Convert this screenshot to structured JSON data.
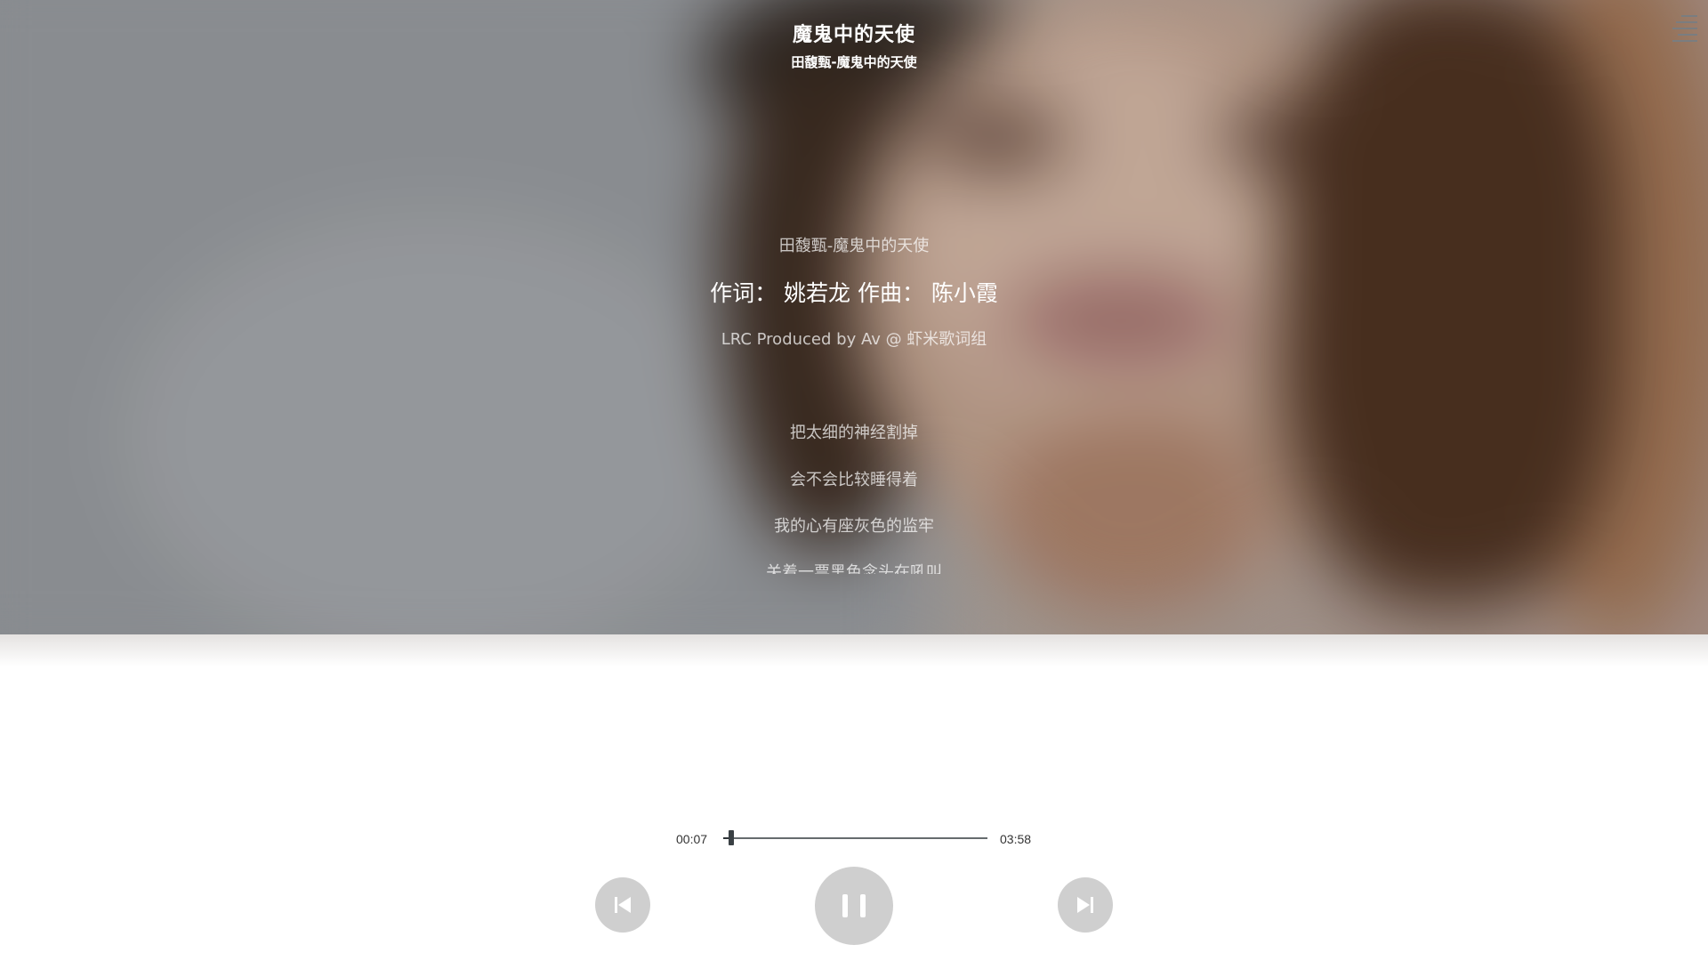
{
  "header": {
    "title": "魔鬼中的天使",
    "subtitle": "田馥甄-魔鬼中的天使"
  },
  "menu": {
    "icon": "menu-icon"
  },
  "lyrics": {
    "lines": [
      "田馥甄-魔鬼中的天使",
      "作词： 姚若龙 作曲： 陈小霞",
      "LRC Produced by Av @ 虾米歌词组",
      "把太细的神经割掉",
      "会不会比较睡得着",
      "我的心有座灰色的监牢",
      "关着一票黑色念头在吼叫"
    ],
    "active_index": 1
  },
  "player": {
    "current_time": "00:07",
    "total_time": "03:58",
    "progress_fraction": 0.029,
    "prev_icon": "skip-previous-icon",
    "play_state_icon": "pause-icon",
    "next_icon": "skip-next-icon"
  },
  "colors": {
    "button_bg": "#cfcfcf",
    "button_icon": "#ffffff",
    "progress_track": "#666b6e",
    "progress_thumb": "#3a4044",
    "time_text": "#333333"
  }
}
